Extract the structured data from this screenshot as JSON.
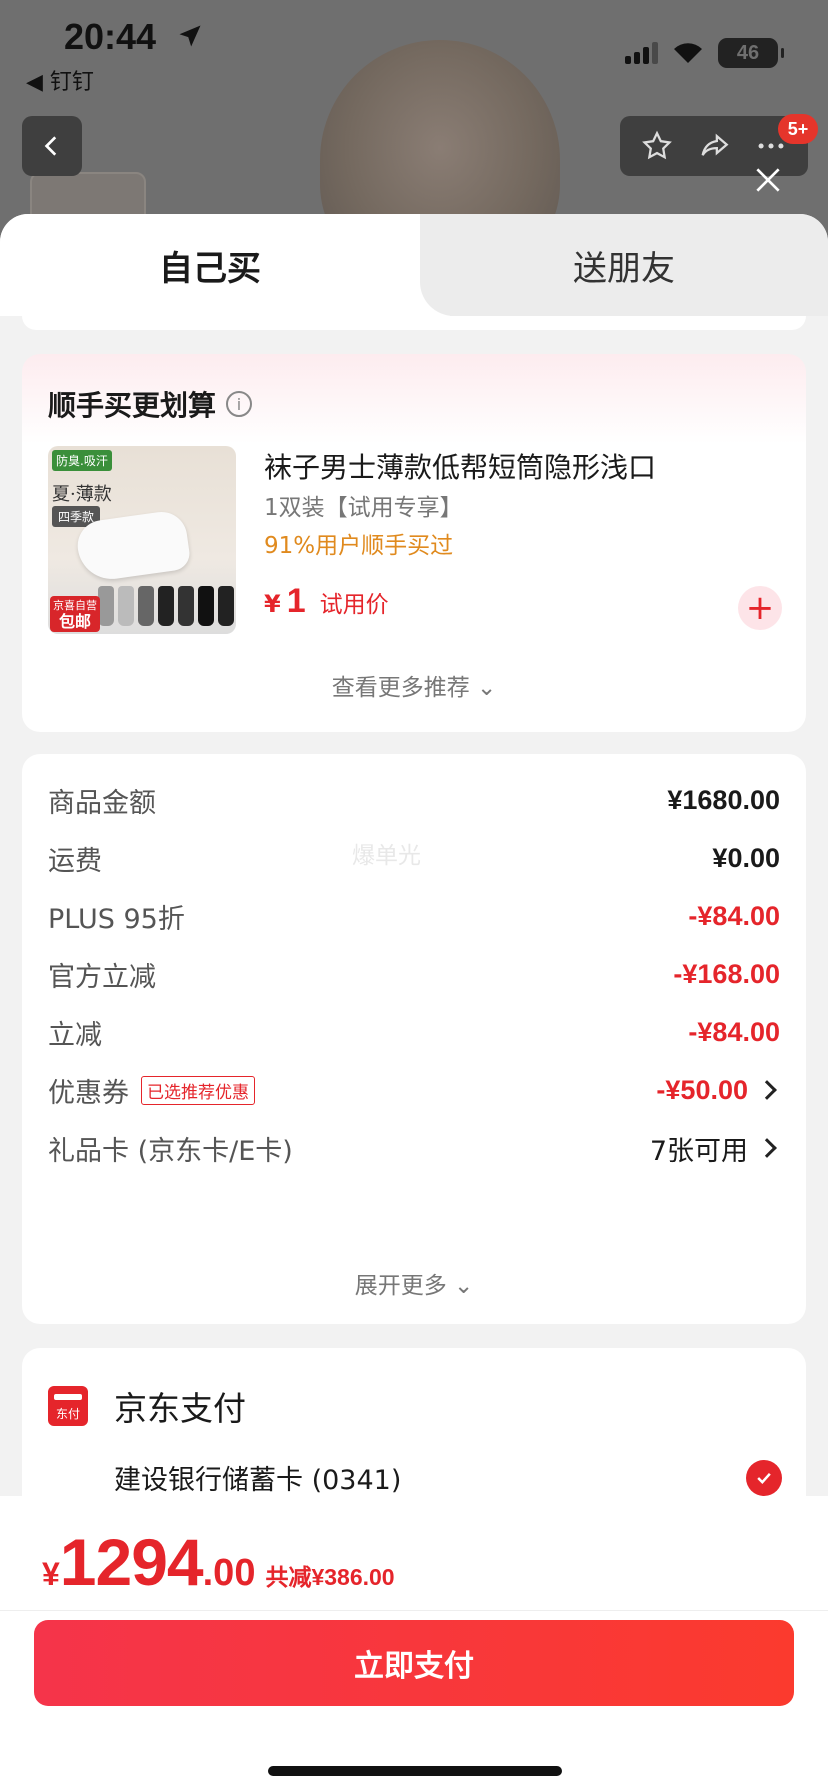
{
  "status": {
    "time": "20:44",
    "back_app": "◀ 钉钉",
    "battery": "46"
  },
  "header": {
    "badge": "5+"
  },
  "tabs": {
    "self": "自己买",
    "friend": "送朋友"
  },
  "recommend": {
    "title": "顺手买更划算",
    "product": {
      "name": "袜子男士薄款低帮短筒隐形浅口",
      "spec": "1双装【试用专享】",
      "bought": "91%用户顺手买过",
      "currency": "¥",
      "price": "1",
      "price_label": "试用价",
      "img_tag1": "防臭.吸汗",
      "img_tag2": "夏·薄款",
      "img_tag3": "四季款",
      "img_badge_top": "京喜自营",
      "img_badge_bottom": "包邮"
    },
    "more": "查看更多推荐 ⌄"
  },
  "amounts": {
    "watermark": "爆单光",
    "rows": [
      {
        "label": "商品金额",
        "value": "¥1680.00"
      },
      {
        "label": "运费",
        "value": "¥0.00"
      },
      {
        "label": "PLUS 95折",
        "value": "-¥84.00"
      },
      {
        "label": "官方立减",
        "value": "-¥168.00"
      },
      {
        "label": "立减",
        "value": "-¥84.00"
      },
      {
        "label": "优惠券",
        "tag": "已选推荐优惠",
        "value": "-¥50.00"
      },
      {
        "label": "礼品卡 (京东卡/E卡)",
        "value": "7张可用"
      }
    ],
    "expand": "展开更多 ⌄"
  },
  "payment": {
    "icon_text": "东付",
    "title": "京东支付",
    "bank": "建设银行储蓄卡 (0341)"
  },
  "footer": {
    "currency": "¥",
    "total_int": "1294",
    "total_dec": ".00",
    "save_label": "共减",
    "save_value": "¥386.00",
    "pay_button": "立即支付"
  },
  "colors": {
    "accent": "#e5252b",
    "orange": "#e08a1e"
  }
}
